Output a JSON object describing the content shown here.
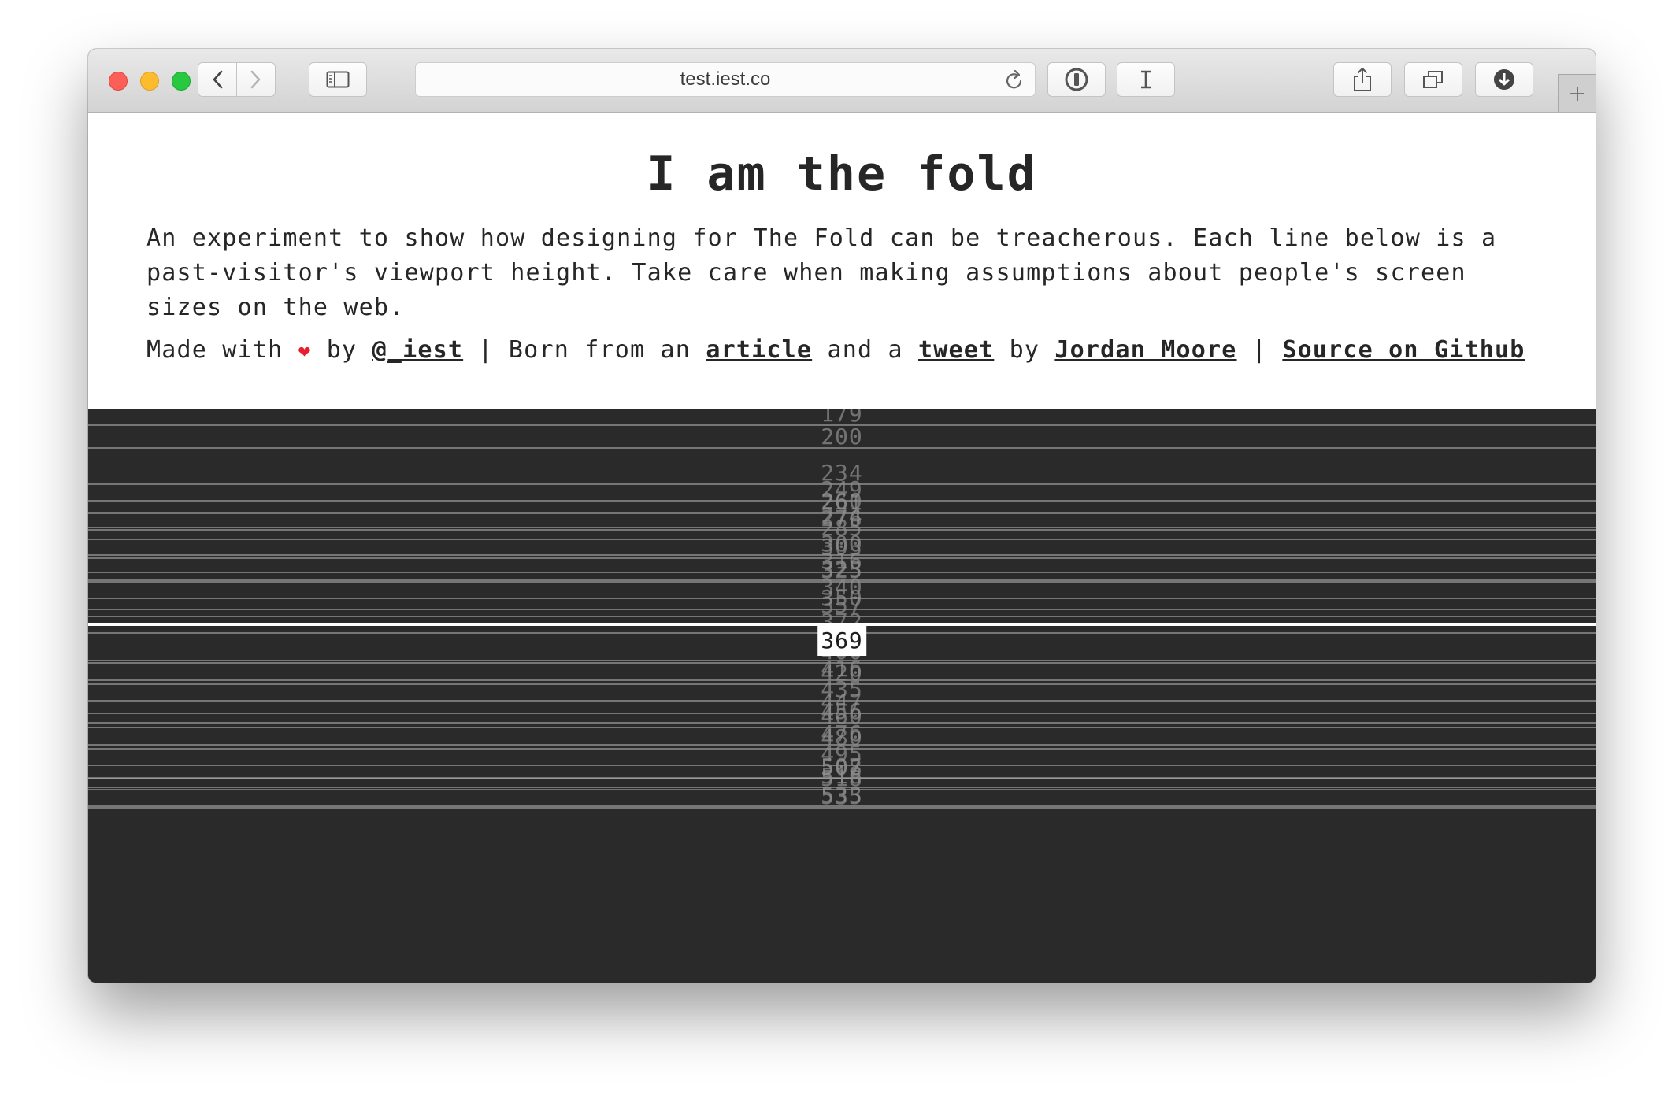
{
  "browser": {
    "url": "test.iest.co",
    "icons": {
      "back": "chevron-left-icon",
      "forward": "chevron-right-icon",
      "sidebar": "sidebar-icon",
      "reload": "reload-icon",
      "password": "1password-icon",
      "reader": "text-cursor-icon",
      "share": "share-icon",
      "tabs": "tabs-overview-icon",
      "downloads": "download-icon",
      "newtab": "plus-icon"
    }
  },
  "page": {
    "title": "I am the fold",
    "description": "An experiment to show how designing for The Fold can be treacherous. Each line below is a past-visitor's viewport height. Take care when making assumptions about people's screen sizes on the web.",
    "credits": {
      "made_with": "Made with",
      "heart": "❤",
      "by1": "by",
      "author": "@_iest",
      "sep1": "|",
      "born": "Born from an",
      "article": "article",
      "and_a": "and a",
      "tweet": "tweet",
      "by2": "by",
      "jordan": "Jordan Moore",
      "sep2": "|",
      "source": "Source on Github"
    }
  },
  "fold": {
    "current_height": "369",
    "accent_color": "#ffffff",
    "heights": [
      179,
      200,
      234,
      249,
      260,
      261,
      274,
      276,
      285,
      300,
      303,
      316,
      323,
      325,
      340,
      350,
      357,
      372,
      398,
      400,
      416,
      420,
      435,
      447,
      456,
      460,
      476,
      480,
      495,
      507,
      508,
      516,
      518,
      533,
      535
    ]
  }
}
